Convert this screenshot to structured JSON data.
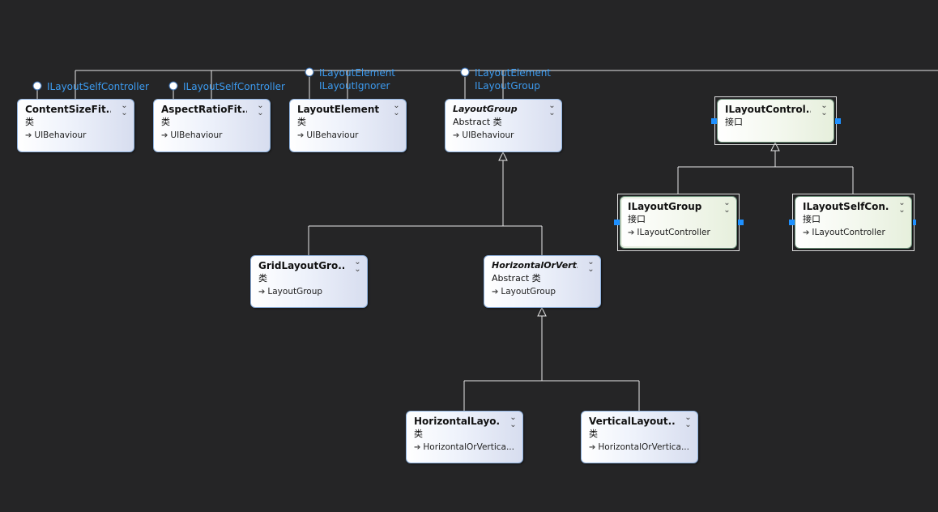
{
  "colors": {
    "background": "#252526",
    "connector": "#e8e8e8",
    "interface_label": "#3c9bf0",
    "class_border": "#8fb2de",
    "interface_fill": "#eef4e6",
    "port": "#1e90ff"
  },
  "icons": {
    "chevron": "double-chevron-down-icon",
    "inherit": "arrow-right-icon",
    "lollipop": "interface-lollipop-icon"
  },
  "lollipops": {
    "content_size_fitter": [
      "ILayoutSelfController"
    ],
    "aspect_ratio_fitter": [
      "ILayoutSelfController"
    ],
    "layout_element": [
      "ILayoutElement",
      "ILayoutIgnorer"
    ],
    "layout_group": [
      "ILayoutElement",
      "ILayoutGroup"
    ]
  },
  "shapes": {
    "content_size_fitter": {
      "name": "ContentSizeFit...",
      "stereotype": "类",
      "base": "UIBehaviour"
    },
    "aspect_ratio_fitter": {
      "name": "AspectRatioFit...",
      "stereotype": "类",
      "base": "UIBehaviour"
    },
    "layout_element": {
      "name": "LayoutElement",
      "stereotype": "类",
      "base": "UIBehaviour"
    },
    "layout_group": {
      "name": "LayoutGroup",
      "stereotype": "Abstract 类",
      "base": "UIBehaviour"
    },
    "grid_layout_group": {
      "name": "GridLayoutGro...",
      "stereotype": "类",
      "base": "LayoutGroup"
    },
    "horizontal_or_vertical": {
      "name": "HorizontalOrVert...",
      "stereotype": "Abstract 类",
      "base": "LayoutGroup"
    },
    "horizontal_layout": {
      "name": "HorizontalLayo...",
      "stereotype": "类",
      "base": "HorizontalOrVertica..."
    },
    "vertical_layout": {
      "name": "VerticalLayout...",
      "stereotype": "类",
      "base": "HorizontalOrVertica..."
    },
    "ilayout_controller": {
      "name": "ILayoutControl...",
      "stereotype": "接口"
    },
    "ilayout_group": {
      "name": "ILayoutGroup",
      "stereotype": "接口",
      "base": "ILayoutController"
    },
    "ilayout_self_controller": {
      "name": "ILayoutSelfCon...",
      "stereotype": "接口",
      "base": "ILayoutController"
    }
  }
}
